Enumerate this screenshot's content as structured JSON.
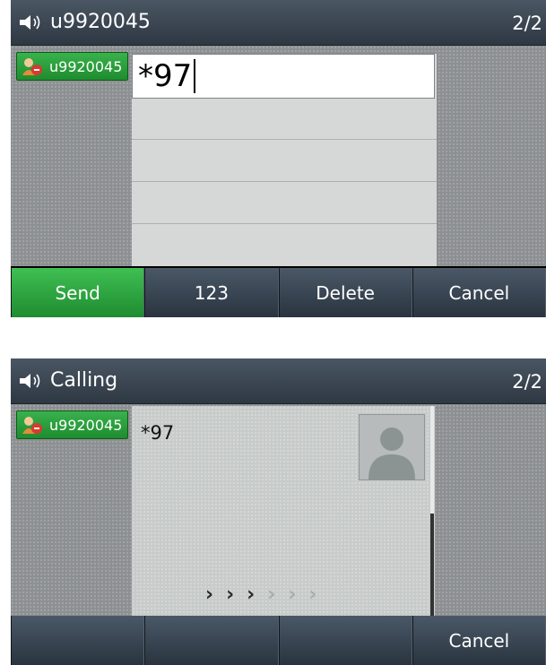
{
  "screen1": {
    "title": "u9920045",
    "page_indicator": "2/2",
    "line_key": "u9920045",
    "dial_input": "*97",
    "softkeys": [
      "Send",
      "123",
      "Delete",
      "Cancel"
    ]
  },
  "screen2": {
    "title": "Calling",
    "page_indicator": "2/2",
    "line_key": "u9920045",
    "call_number": "*97",
    "softkeys": [
      "",
      "",
      "",
      "Cancel"
    ]
  },
  "icons": {
    "speaker": "speaker-icon",
    "account": "account-status-icon",
    "contact": "contact-avatar-icon",
    "progress": "calling-progress-arrows"
  },
  "colors": {
    "title_bar": "#2e3843",
    "softkey": "#2a3440",
    "send_green": "#1f8c30",
    "line_key_green": "#1e8c2f"
  }
}
